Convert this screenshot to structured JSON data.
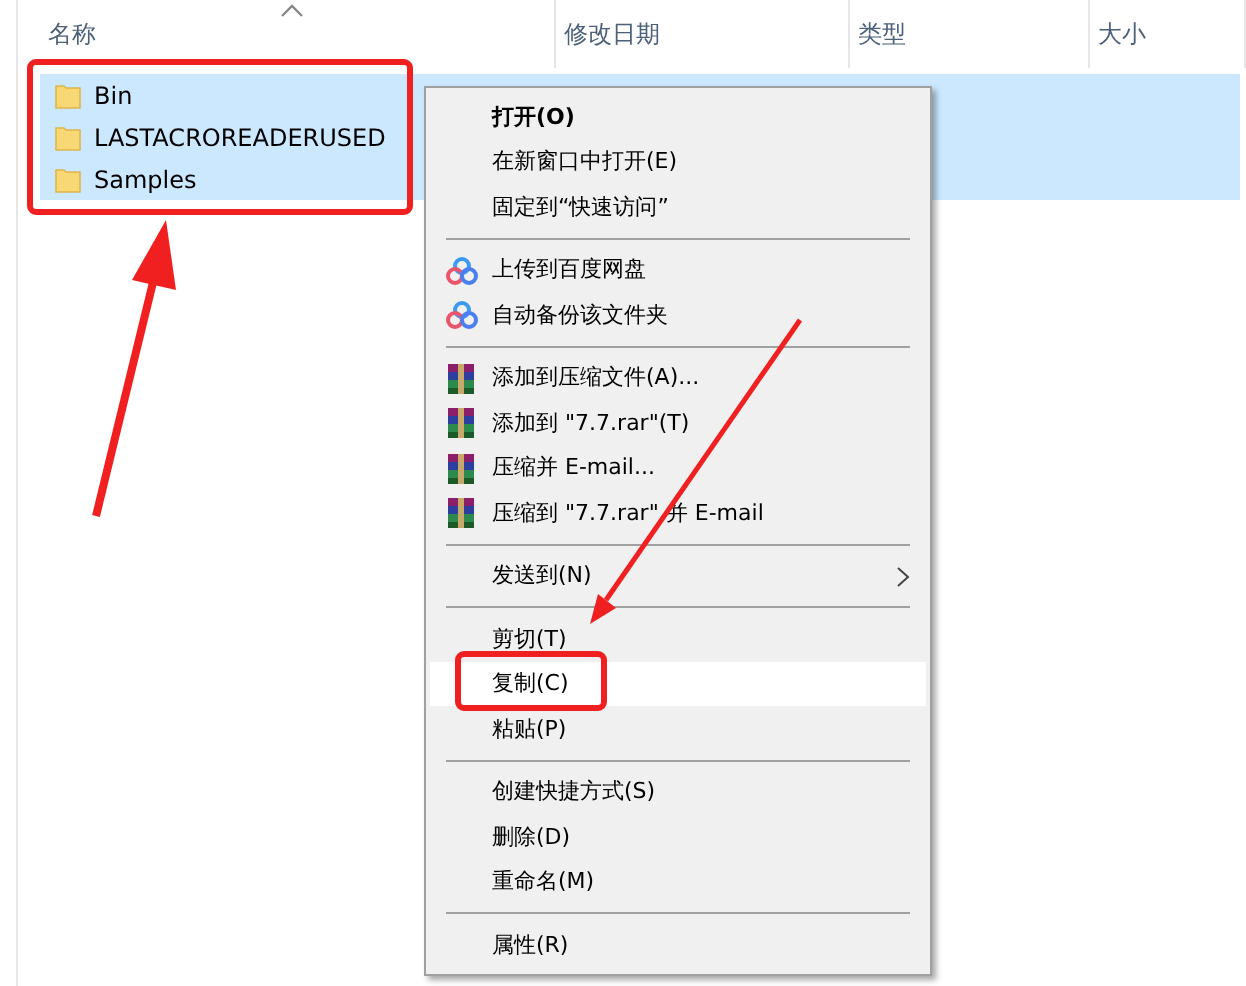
{
  "columns": [
    {
      "label": "名称",
      "sorted": true
    },
    {
      "label": "修改日期",
      "sorted": false
    },
    {
      "label": "类型",
      "sorted": false
    },
    {
      "label": "大小",
      "sorted": false
    }
  ],
  "files": [
    {
      "name": "Bin",
      "selected": true
    },
    {
      "name": "LASTACROREADERUSED",
      "selected": true
    },
    {
      "name": "Samples",
      "selected": true
    }
  ],
  "context_menu": [
    {
      "kind": "item",
      "label": "打开(O)",
      "bold": true,
      "selected": false
    },
    {
      "kind": "item",
      "label": "在新窗口中打开(E)",
      "bold": false,
      "selected": false
    },
    {
      "kind": "item",
      "label": "固定到“快速访问”",
      "bold": false,
      "selected": false
    },
    {
      "kind": "separator"
    },
    {
      "kind": "cloud",
      "label": "上传到百度网盘",
      "bold": false,
      "selected": false
    },
    {
      "kind": "cloud",
      "label": "自动备份该文件夹",
      "bold": false,
      "selected": false
    },
    {
      "kind": "separator"
    },
    {
      "kind": "archive",
      "label": "添加到压缩文件(A)...",
      "bold": false,
      "selected": false
    },
    {
      "kind": "archive",
      "label": "添加到 \"7.7.rar\"(T)",
      "bold": false,
      "selected": false
    },
    {
      "kind": "archive",
      "label": "压缩并 E-mail...",
      "bold": false,
      "selected": false
    },
    {
      "kind": "archive",
      "label": "压缩到 \"7.7.rar\" 并 E-mail",
      "bold": false,
      "selected": false
    },
    {
      "kind": "separator"
    },
    {
      "kind": "submenu",
      "label": "发送到(N)",
      "bold": false,
      "selected": false
    },
    {
      "kind": "separator"
    },
    {
      "kind": "item",
      "label": "剪切(T)",
      "bold": false,
      "selected": false
    },
    {
      "kind": "item",
      "label": "复制(C)",
      "bold": false,
      "selected": true
    },
    {
      "kind": "item",
      "label": "粘贴(P)",
      "bold": false,
      "selected": false
    },
    {
      "kind": "separator"
    },
    {
      "kind": "item",
      "label": "创建快捷方式(S)",
      "bold": false,
      "selected": false
    },
    {
      "kind": "item",
      "label": "删除(D)",
      "bold": false,
      "selected": false
    },
    {
      "kind": "item",
      "label": "重命名(M)",
      "bold": false,
      "selected": false
    },
    {
      "kind": "separator"
    },
    {
      "kind": "item",
      "label": "属性(R)",
      "bold": false,
      "selected": false
    }
  ]
}
